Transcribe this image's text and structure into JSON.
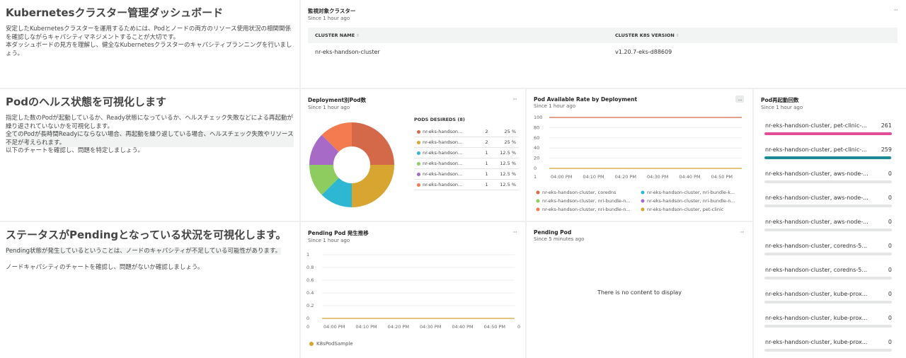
{
  "intro": {
    "title": "Kubernetesクラスター管理ダッシュボード",
    "p1": "安定したKubernetesクラスターを運用するためには、Podとノードの両方のリソース使用状況の相関関係を確認しながらキャパシティマネジメントすることが大切です。",
    "p2": "本ダッシュボードの見方を理解し、健全なKubernetesクラスターのキャパシティプランニングを行いましょう。"
  },
  "cluster_widget": {
    "title": "監視対象クラスター",
    "since": "Since 1 hour ago",
    "columns": [
      "CLUSTER NAME",
      "CLUSTER K8S VERSION"
    ],
    "rows": [
      [
        "nr-eks-handson-cluster",
        "v1.20.7-eks-d88609"
      ]
    ]
  },
  "pod_health": {
    "title": "Podのヘルス状態を可視化します",
    "p1": "指定した数のPodが起動しているか、Ready状態になっているか、ヘルスチェック失敗などによる再起動が繰り返されていないかを可視化します。",
    "p2": "全てのPodが長時間Readyにならない場合、再起動を繰り返している場合、ヘルスチェック失敗やリソース不足が考えられます。",
    "p3": "以下のチャートを確認し、問題を特定しましょう。"
  },
  "deployment_widget": {
    "title": "Deployment別Pod数",
    "since": "Since 1 hour ago",
    "legend_title": "PODS DESIREDS (8)",
    "rows": [
      {
        "name": "nr-eks-handson...",
        "count": "2",
        "pct": "25 %",
        "color": "#d4694a"
      },
      {
        "name": "nr-eks-handson...",
        "count": "2",
        "pct": "25 %",
        "color": "#d7a530"
      },
      {
        "name": "nr-eks-handson...",
        "count": "1",
        "pct": "12.5 %",
        "color": "#2eb7d3"
      },
      {
        "name": "nr-eks-handson...",
        "count": "1",
        "pct": "12.5 %",
        "color": "#8fcc5f"
      },
      {
        "name": "nr-eks-handson...",
        "count": "1",
        "pct": "12.5 %",
        "color": "#a86ac7"
      },
      {
        "name": "nr-eks-handson...",
        "count": "1",
        "pct": "12.5 %",
        "color": "#f47b4f"
      }
    ]
  },
  "available_rate_widget": {
    "title": "Pod Available Rate by Deployment",
    "since": "Since 1 hour ago",
    "more": "...",
    "legend": [
      {
        "label": "nr-eks-handson-cluster, coredns",
        "color": "#d4694a"
      },
      {
        "label": "nr-eks-handson-cluster, nri-bundle-k...",
        "color": "#2eb7d3"
      },
      {
        "label": "nr-eks-handson-cluster, nri-bundle-n...",
        "color": "#8fcc5f"
      },
      {
        "label": "nr-eks-handson-cluster, nri-bundle-n...",
        "color": "#a86ac7"
      },
      {
        "label": "nr-eks-handson-cluster, nri-bundle-n...",
        "color": "#f47b4f"
      },
      {
        "label": "nr-eks-handson-cluster, pet-clinic",
        "color": "#d7a530"
      }
    ]
  },
  "restarts_widget": {
    "title": "Pod再起動回数",
    "since": "Since 1 hour ago",
    "max": 261,
    "rows": [
      {
        "label": "nr-eks-handson-cluster, pet-clinic-...",
        "value": 261,
        "color": "#e24d9a"
      },
      {
        "label": "nr-eks-handson-cluster, pet-clinic-...",
        "value": 259,
        "color": "#1a8a99"
      },
      {
        "label": "nr-eks-handson-cluster, aws-node-...",
        "value": 0,
        "color": "#1a8a99"
      },
      {
        "label": "nr-eks-handson-cluster, aws-node-...",
        "value": 0,
        "color": "#1a8a99"
      },
      {
        "label": "nr-eks-handson-cluster, aws-node-...",
        "value": 0,
        "color": "#1a8a99"
      },
      {
        "label": "nr-eks-handson-cluster, coredns-5...",
        "value": 0,
        "color": "#1a8a99"
      },
      {
        "label": "nr-eks-handson-cluster, coredns-5...",
        "value": 0,
        "color": "#1a8a99"
      },
      {
        "label": "nr-eks-handson-cluster, kube-prox...",
        "value": 0,
        "color": "#1a8a99"
      },
      {
        "label": "nr-eks-handson-cluster, kube-prox...",
        "value": 0,
        "color": "#1a8a99"
      },
      {
        "label": "nr-eks-handson-cluster, kube-prox...",
        "value": 0,
        "color": "#1a8a99"
      }
    ]
  },
  "pending_text": {
    "title": "ステータスがPendingとなっている状況を可視化します。",
    "p1": "Pending状態が発生しているということは、ノードのキャパシティが不足している可能性があります。",
    "p2": "ノードキャパシティのチャートを確認し、問題がないか確認しましょう。"
  },
  "pending_trend_widget": {
    "title": "Pending Pod 発生推移",
    "since": "Since 1 hour ago",
    "legend": "K8sPodSample",
    "legend_color": "#d7a530"
  },
  "pending_pod_widget": {
    "title": "Pending Pod",
    "since": "Since 5 minutes ago",
    "empty": "There is no content to display"
  },
  "chart_data": [
    {
      "type": "pie",
      "title": "Deployment別Pod数",
      "categories": [
        "nr-eks-handson...",
        "nr-eks-handson...",
        "nr-eks-handson...",
        "nr-eks-handson...",
        "nr-eks-handson...",
        "nr-eks-handson..."
      ],
      "values": [
        2,
        2,
        1,
        1,
        1,
        1
      ],
      "colors": [
        "#d4694a",
        "#d7a530",
        "#2eb7d3",
        "#8fcc5f",
        "#a86ac7",
        "#f47b4f"
      ]
    },
    {
      "type": "line",
      "title": "Pod Available Rate by Deployment",
      "ylim": [
        0,
        100
      ],
      "yticks": [
        "100",
        "80",
        "60",
        "40",
        "20",
        "0"
      ],
      "xticks": [
        "04:00 PM",
        "04:10 PM",
        "04:20 PM",
        "04:30 PM",
        "04:40 PM",
        "04:50 PM"
      ],
      "x_start_label": "1",
      "series": [
        {
          "name": "nr-eks-handson-cluster, coredns",
          "value": 100,
          "color": "#d4694a"
        },
        {
          "name": "nr-eks-handson-cluster, pet-clinic",
          "value": 0,
          "color": "#d7a530"
        }
      ],
      "legend_placement": "bottom"
    },
    {
      "type": "line",
      "title": "Pending Pod 発生推移",
      "ylim": [
        0,
        1
      ],
      "yticks": [
        "1",
        "0.8",
        "0.6",
        "0.4",
        "0.2",
        "0"
      ],
      "xticks": [
        "04:00 PM",
        "04:10 PM",
        "04:20 PM",
        "04:30 PM",
        "04:40 PM",
        "04:50 PM"
      ],
      "x_start_label": "0",
      "x_end_label": "0",
      "series": [
        {
          "name": "K8sPodSample",
          "value": 0,
          "color": "#d7a530"
        }
      ],
      "legend_placement": "bottom"
    }
  ]
}
